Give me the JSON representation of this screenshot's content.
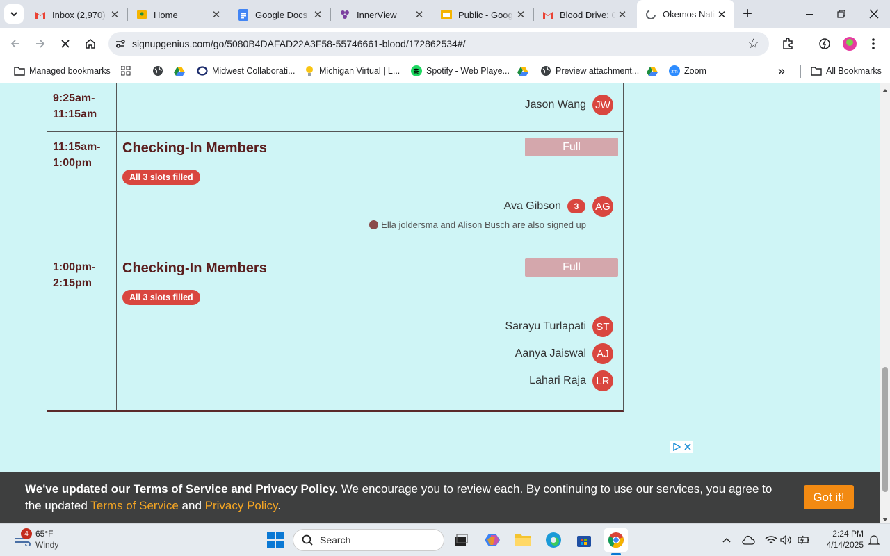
{
  "browser": {
    "tabs": [
      {
        "title": "Inbox (2,970) -",
        "icon": "gmail-icon"
      },
      {
        "title": "Home",
        "icon": "classroom-icon"
      },
      {
        "title": "Google Docs",
        "icon": "docs-icon"
      },
      {
        "title": "InnerView",
        "icon": "innerview-icon"
      },
      {
        "title": "Public - Goog",
        "icon": "slides-icon"
      },
      {
        "title": "Blood Drive: C",
        "icon": "gmail-icon"
      },
      {
        "title": "Okemos Natio",
        "icon": "loading-icon"
      }
    ],
    "close_glyph": "✕",
    "new_tab_glyph": "+",
    "url": "signupgenius.com/go/5080B4DAFAD22A3F58-55746661-blood/172862534#/",
    "bookmarks": [
      {
        "label": "Managed bookmarks",
        "icon": "folder-icon"
      },
      {
        "label": "",
        "icon": "apps-grid-icon"
      },
      {
        "label": "",
        "icon": "globe-icon"
      },
      {
        "label": "",
        "icon": "drive-icon"
      },
      {
        "label": "Midwest Collaborati...",
        "icon": "ring-icon"
      },
      {
        "label": "Michigan Virtual | L...",
        "icon": "bulb-icon"
      },
      {
        "label": "Spotify - Web Playe...",
        "icon": "spotify-icon"
      },
      {
        "label": "",
        "icon": "drive-icon"
      },
      {
        "label": "Preview attachment...",
        "icon": "globe-icon"
      },
      {
        "label": "",
        "icon": "drive-icon"
      },
      {
        "label": "Zoom",
        "icon": "zoom-icon"
      }
    ],
    "more_bookmarks_glyph": "»",
    "all_bookmarks": "All Bookmarks"
  },
  "signup": {
    "rows": [
      {
        "time": "9:25am-\n11:15am",
        "people": [
          {
            "name": "Jason Wang",
            "initials": "JW"
          }
        ]
      },
      {
        "time": "11:15am-\n1:00pm",
        "slot": "Checking-In Members",
        "button": "Full",
        "badge": "All 3 slots filled",
        "people": [
          {
            "name": "Ava Gibson",
            "initials": "AG",
            "count": "3"
          }
        ],
        "also": "Ella joldersma and Alison Busch are also signed up"
      },
      {
        "time": "1:00pm-\n2:15pm",
        "slot": "Checking-In Members",
        "button": "Full",
        "badge": "All 3 slots filled",
        "people": [
          {
            "name": "Sarayu Turlapati",
            "initials": "ST"
          },
          {
            "name": "Aanya Jaiswal",
            "initials": "AJ"
          },
          {
            "name": "Lahari Raja",
            "initials": "LR"
          }
        ]
      }
    ]
  },
  "cookie": {
    "bold": "We've updated our Terms of Service and Privacy Policy.",
    "text1": " We encourage you to review each. By continuing to use our services, you agree to the updated ",
    "tos": "Terms of Service",
    "and": " and ",
    "privacy": "Privacy Policy",
    "end": ".",
    "button": "Got it!"
  },
  "taskbar": {
    "weather_badge": "4",
    "temp": "65°F",
    "condition": "Windy",
    "search_placeholder": "Search",
    "time": "2:24 PM",
    "date": "4/14/2025"
  },
  "colors": {
    "page_bg": "#cff5f6",
    "accent_red": "#d9463f",
    "dark_red": "#5a1e1e",
    "orange": "#f28a12"
  }
}
